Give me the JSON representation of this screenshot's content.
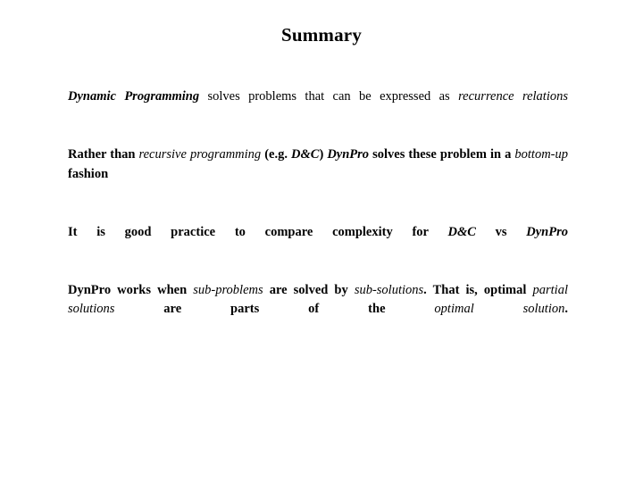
{
  "slide": {
    "title": "Summary",
    "background_color": "#ffffff",
    "text_color": "#000000",
    "paragraphs": [
      {
        "id": "p1",
        "plain": "Dynamic Programming solves problems that can be expressed as recurrence relations",
        "weight": "regular",
        "runs": [
          {
            "text": "Dynamic Programming",
            "style": "bold-italic"
          },
          {
            "text": " solves problems that can be expressed as ",
            "style": "regular"
          },
          {
            "text": "recurrence relations",
            "style": "italic"
          }
        ]
      },
      {
        "id": "p2",
        "plain": "Rather than recursive programming (e.g. D&C) DynPro solves these problem in a bottom-up fashion",
        "weight": "bold",
        "runs": [
          {
            "text": "Rather than ",
            "style": "bold"
          },
          {
            "text": "recursive programming",
            "style": "italic"
          },
          {
            "text": " (e.g. ",
            "style": "bold"
          },
          {
            "text": "D&C",
            "style": "bold-italic"
          },
          {
            "text": ") ",
            "style": "bold"
          },
          {
            "text": "DynPro",
            "style": "bold-italic"
          },
          {
            "text": " solves these problem in a ",
            "style": "bold"
          },
          {
            "text": "bottom-up",
            "style": "italic"
          },
          {
            "text": " fashion",
            "style": "bold"
          }
        ]
      },
      {
        "id": "p3",
        "plain": "It is good practice to compare complexity for D&C vs DynPro",
        "weight": "bold",
        "runs": [
          {
            "text": "It is good practice to compare complexity for ",
            "style": "bold"
          },
          {
            "text": "D&C",
            "style": "bold-italic"
          },
          {
            "text": " vs ",
            "style": "bold"
          },
          {
            "text": "DynPro",
            "style": "bold-italic"
          }
        ]
      },
      {
        "id": "p4",
        "plain": "DynPro works when sub-problems are solved by sub-solutions. That is, optimal partial solutions are parts of the optimal solution.",
        "weight": "bold",
        "runs": [
          {
            "text": "DynPro works when ",
            "style": "bold"
          },
          {
            "text": "sub-problems",
            "style": "italic"
          },
          {
            "text": " are solved by ",
            "style": "bold"
          },
          {
            "text": "sub-solutions",
            "style": "italic"
          },
          {
            "text": ". That is, optimal ",
            "style": "bold"
          },
          {
            "text": "partial solutions",
            "style": "italic"
          },
          {
            "text": " are parts of the ",
            "style": "bold"
          },
          {
            "text": "optimal solution",
            "style": "italic"
          },
          {
            "text": ".",
            "style": "bold"
          }
        ]
      }
    ]
  }
}
